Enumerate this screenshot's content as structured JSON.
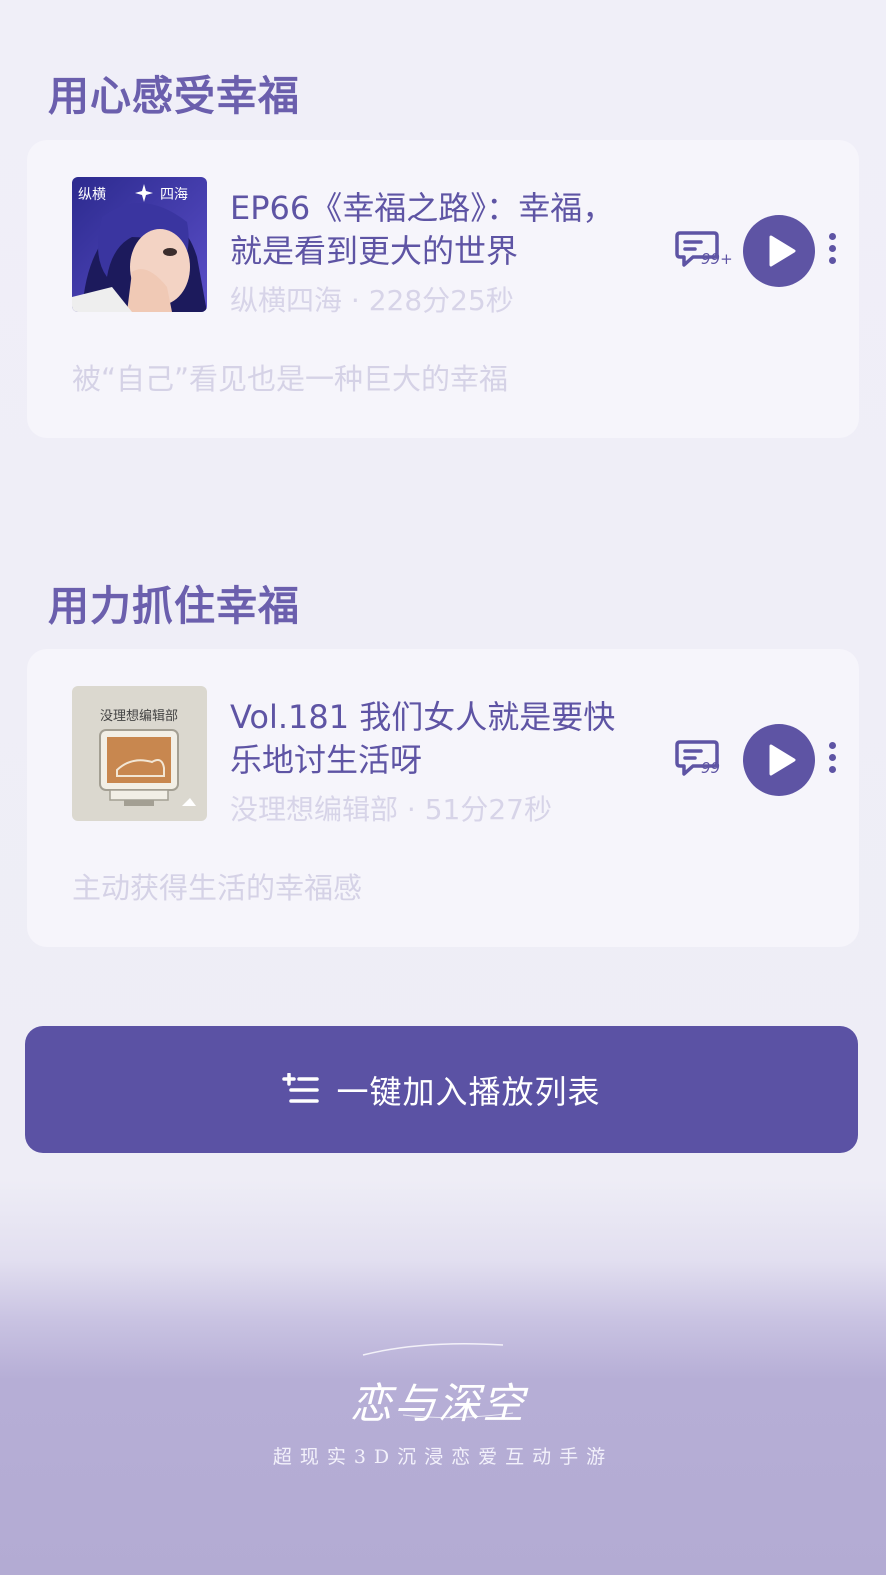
{
  "sections": [
    {
      "title": "用心感受幸福",
      "episode": {
        "title": "EP66《幸福之路》：幸福，就是看到更大的世界",
        "meta": "纵横四海 · 228分25秒",
        "description": "被“自己”看见也是一种巨大的幸福",
        "comment_count": "99+",
        "cover_text_left": "纵横",
        "cover_text_right": "四海"
      }
    },
    {
      "title": "用力抓住幸福",
      "episode": {
        "title": "Vol.181 我们女人就是要快乐地讨生活呀",
        "meta": "没理想编辑部 · 51分27秒",
        "description": "主动获得生活的幸福感",
        "comment_count": "99",
        "cover_text": "没理想编辑部"
      }
    }
  ],
  "add_all_button": {
    "label": "一键加入播放列表",
    "icon": "playlist-add-icon"
  },
  "footer": {
    "logo_text": "恋与深空",
    "tagline": "超现实3D沉浸恋爱互动手游"
  },
  "colors": {
    "accent": "#5e54a4",
    "section_title": "#6b5fad",
    "muted_text": "#d7d4e8",
    "card_bg": "#f6f5fb"
  }
}
